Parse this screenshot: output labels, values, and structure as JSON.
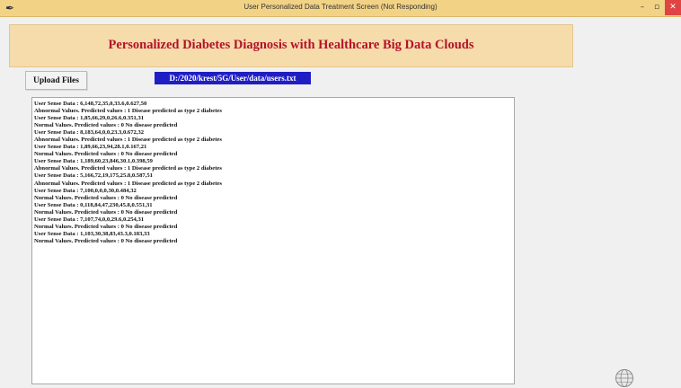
{
  "window": {
    "title": "User Personalized Data Treatment Screen (Not Responding)",
    "app_icon": "feather-icon",
    "controls": {
      "minimize": "–",
      "maximize": "▫",
      "close": "✕"
    },
    "colors": {
      "titlebar": "#f2d386",
      "close": "#e04343"
    }
  },
  "banner": {
    "heading": "Personalized Diabetes Diagnosis with Healthcare Big Data Clouds",
    "colors": {
      "background": "#f6dcaa",
      "text": "#b3122a"
    }
  },
  "toolbar": {
    "upload_label": "Upload Files",
    "file_path": "D:/2020/krest/5G/User/data/users.txt",
    "colors": {
      "path_background": "#1f1ec4",
      "path_text": "#ffffff"
    }
  },
  "output": {
    "lines": [
      "User Sense Data : 6,148,72,35,0,33.6,0.627,50",
      "Abnormal Values. Predicted values : 1 Disease predicted as type 2 diabetes",
      "User Sense Data : 1,85,66,29,0,26.6,0.351,31",
      "Normal Values. Predicted values : 0 No disease predicted",
      "User Sense Data : 8,183,64,0,0,23.3,0.672,32",
      "Abnormal Values. Predicted values : 1 Disease predicted as type 2 diabetes",
      "User Sense Data : 1,89,66,23,94,28.1,0.167,21",
      "Normal Values. Predicted values : 0 No disease predicted",
      "User Sense Data : 1,189,60,23,846,30.1,0.398,59",
      "Abnormal Values. Predicted values : 1 Disease predicted as type 2 diabetes",
      "User Sense Data : 5,166,72,19,175,25.8,0.587,51",
      "Abnormal Values. Predicted values : 1 Disease predicted as type 2 diabetes",
      "User Sense Data : 7,100,0,0,0,30,0.484,32",
      "Normal Values. Predicted values : 0 No disease predicted",
      "User Sense Data : 0,118,84,47,230,45.8,0.551,31",
      "Normal Values. Predicted values : 0 No disease predicted",
      "User Sense Data : 7,107,74,0,0,29.6,0.254,31",
      "Normal Values. Predicted values : 0 No disease predicted",
      "User Sense Data : 1,103,30,38,83,43.3,0.183,33",
      "Normal Values. Predicted values : 0 No disease predicted"
    ]
  },
  "corner_icon": "globe-icon"
}
